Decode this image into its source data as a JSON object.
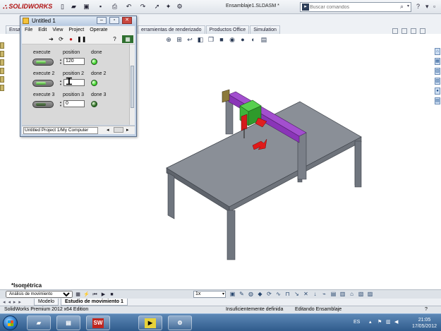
{
  "solidworks": {
    "brand": "SOLIDWORKS",
    "document_title": "Ensamblaje1.SLDASM *",
    "search_placeholder": "Buscar comandos",
    "tabs": [
      "Ensa",
      "erramientas de renderizado",
      "Productos Office",
      "Simulation"
    ],
    "view_orientation": "*Isométrica",
    "triad_axes": [
      "X",
      "Y",
      "Z"
    ],
    "motion": {
      "study_type": "Análisis de movimiento",
      "speed": "1x"
    },
    "bottom_tabs": [
      "Modelo",
      "Estudio de movimiento 1"
    ],
    "bottom_nav": "◂ ◂ ▸ ▸",
    "status": {
      "product": "SolidWorks Premium 2012 x64 Edition",
      "definition": "Insuficientemente definida",
      "mode": "Editando Ensamblaje",
      "help": "?"
    }
  },
  "labview": {
    "window_title": "Untitled 1",
    "menu": [
      "File",
      "Edit",
      "View",
      "Project",
      "Operate"
    ],
    "status_path": "Untitled Project 1/My Computer",
    "controls": [
      {
        "button_label": "execute",
        "position_label": "position",
        "position_value": "120",
        "done_label": "done",
        "done_on": true,
        "button_on": true
      },
      {
        "button_label": "execute 2",
        "position_label": "position 2",
        "position_value": "",
        "done_label": "done 2",
        "done_on": true,
        "button_on": true
      },
      {
        "button_label": "execute 3",
        "position_label": "position 3",
        "position_value": "0",
        "done_label": "done 3",
        "done_on": false,
        "button_on": false
      }
    ],
    "colors": {
      "led_on": "#3ed62a",
      "led_off": "#2b6a22"
    }
  },
  "taskbar": {
    "language": "ES",
    "time": "21:05",
    "date": "17/05/2012",
    "apps": [
      "folder-icon",
      "file-icon",
      "solidworks-icon",
      "labview-icon",
      "settings-app-icon"
    ]
  },
  "colors": {
    "tabletop": "#8a8f97",
    "frame_legs": "#6f757e",
    "gantry_beam": "#a34fcf",
    "carriage": "#3eb53a",
    "tool_red": "#e02020",
    "gantry_post": "#7a7f88"
  }
}
